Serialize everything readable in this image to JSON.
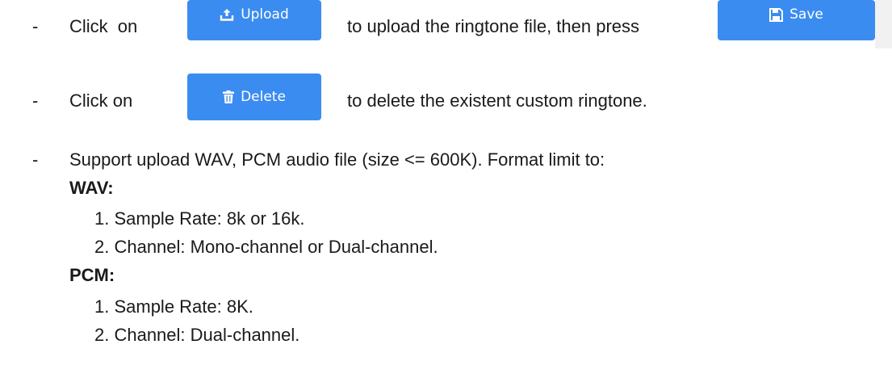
{
  "lines": {
    "line1": {
      "dash": "-",
      "click_on": "Click   on",
      "after_upload": "to upload the ringtone file, then press"
    },
    "line2": {
      "dash": "-",
      "click_on": "Click on",
      "after_delete": "to delete the existent custom ringtone."
    },
    "line3": {
      "dash": "-",
      "text": "Support upload WAV, PCM audio file (size <= 600K). Format limit to:"
    }
  },
  "buttons": {
    "upload": {
      "label": "Upload",
      "icon": "upload-icon"
    },
    "save": {
      "label": "Save",
      "icon": "floppy-disk-icon"
    },
    "delete": {
      "label": "Delete",
      "icon": "trash-icon"
    }
  },
  "wav": {
    "heading": "WAV:",
    "items": [
      "1. Sample Rate: 8k or 16k.",
      "2. Channel: Mono-channel or Dual-channel."
    ]
  },
  "pcm": {
    "heading": "PCM:",
    "items": [
      "1. Sample Rate: 8K.",
      "2. Channel: Dual-channel."
    ]
  },
  "colors": {
    "button_blue": "#3b8cf0",
    "text": "#1a1a1a"
  }
}
